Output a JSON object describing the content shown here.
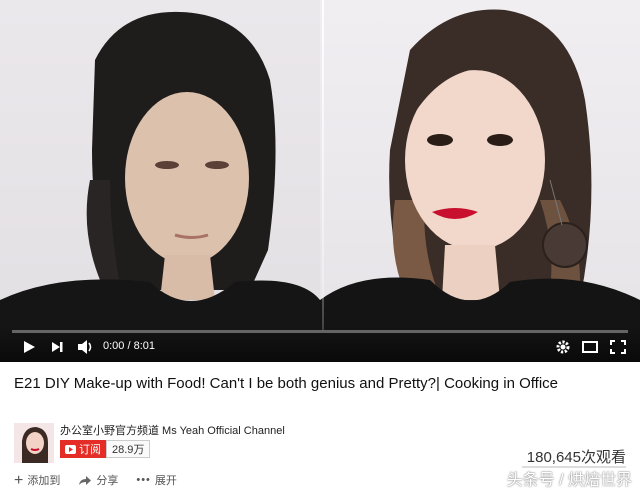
{
  "player": {
    "time_current": "0:00",
    "time_total": "8:01",
    "progress_fraction": 0,
    "icons": {
      "play": "play-icon",
      "next": "next-icon",
      "volume": "volume-icon",
      "settings": "gear-icon",
      "theater": "theater-icon",
      "fullscreen": "fullscreen-icon"
    }
  },
  "video": {
    "title": "E21 DIY Make-up with Food! Can't I be both genius and Pretty?| Cooking in Office"
  },
  "channel": {
    "name": "办公室小野官方频道 Ms Yeah Official Channel",
    "subscribe_label": "订阅",
    "subscriber_count": "28.9万"
  },
  "stats": {
    "views": "180,645次观看"
  },
  "actions": {
    "add_to": "添加到",
    "share": "分享",
    "more": "展开"
  },
  "watermark": "头条号 / 烘焙世界",
  "colors": {
    "accent": "#e52d27",
    "lip": "#c8102e"
  }
}
